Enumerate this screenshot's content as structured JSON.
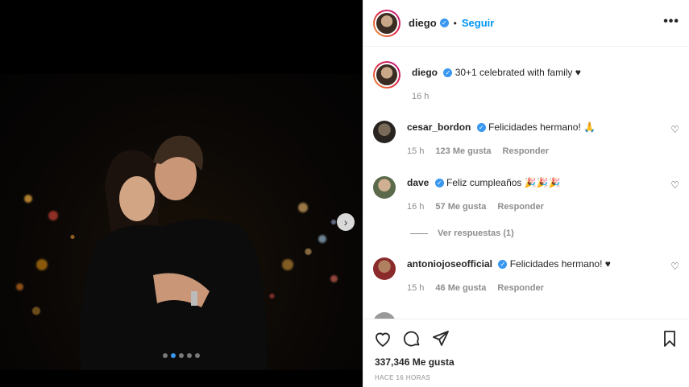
{
  "post": {
    "username": "diego",
    "follow_label": "Seguir",
    "bullet": "•",
    "more": "•••",
    "verified_mark": "✓",
    "carousel": {
      "slides": 5,
      "active_index": 1
    },
    "caption": {
      "text": "30+1 celebrated with family ♥",
      "time": "16 h"
    }
  },
  "comments": [
    {
      "user": "cesar_bordon",
      "text": "Felicidades hermano! 🙏",
      "time": "15 h",
      "likes": "123 Me gusta",
      "reply": "Responder"
    },
    {
      "user": "dave",
      "text": "Feliz cumpleaños 🎉🎉🎉",
      "time": "16 h",
      "likes": "57 Me gusta",
      "reply": "Responder"
    },
    {
      "user": "antoniojoseofficial",
      "text": "Felicidades hermano! ♥",
      "time": "15 h",
      "likes": "46 Me gusta",
      "reply": "Responder"
    }
  ],
  "view_replies": "Ver respuestas (1)",
  "footer": {
    "likes": "337,346 Me gusta",
    "time_ago": "HACE 16 HORAS"
  },
  "icons": {
    "like": "heart-icon",
    "comment": "comment-icon",
    "share": "share-icon",
    "save": "bookmark-icon",
    "next": "chevron-right-icon"
  },
  "colors": {
    "link_blue": "#0095f6",
    "verified_blue": "#3897f0",
    "muted": "#8e8e8e"
  }
}
